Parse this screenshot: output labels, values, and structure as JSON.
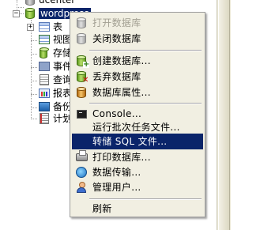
{
  "tree": {
    "items": [
      {
        "label": "ucenter"
      },
      {
        "label": "wordpress",
        "expander": "−"
      },
      {
        "label": "表",
        "expander": "+"
      },
      {
        "label": "视图"
      },
      {
        "label": "存储"
      },
      {
        "label": "事件"
      },
      {
        "label": "查询"
      },
      {
        "label": "报表"
      },
      {
        "label": "备份"
      },
      {
        "label": "计划"
      }
    ]
  },
  "context_menu": {
    "items": [
      {
        "label": "打开数据库",
        "icon": "database-icon",
        "enabled": false
      },
      {
        "label": "关闭数据库",
        "icon": "database-icon",
        "enabled": true
      },
      {
        "label": "创建数据库...",
        "icon": "database-add-icon",
        "enabled": true
      },
      {
        "label": "丢弃数据库",
        "icon": "database-delete-icon",
        "enabled": true
      },
      {
        "label": "数据库属性...",
        "icon": "database-properties-icon",
        "enabled": true
      },
      {
        "label": "Console...",
        "icon": "console-icon",
        "enabled": true
      },
      {
        "label": "运行批次任务文件...",
        "icon": "",
        "enabled": true
      },
      {
        "label": "转储 SQL 文件...",
        "icon": "",
        "enabled": true,
        "highlighted": true
      },
      {
        "label": "打印数据库...",
        "icon": "printer-icon",
        "enabled": true
      },
      {
        "label": "数据传输...",
        "icon": "data-transfer-icon",
        "enabled": true
      },
      {
        "label": "管理用户...",
        "icon": "user-icon",
        "enabled": true
      },
      {
        "label": "刷新",
        "icon": "",
        "enabled": true
      }
    ]
  },
  "colors": {
    "menu_background": "#f1efe2",
    "highlight": "#0a246a",
    "disabled_text": "#a29f92",
    "selection": "#0a246a"
  }
}
